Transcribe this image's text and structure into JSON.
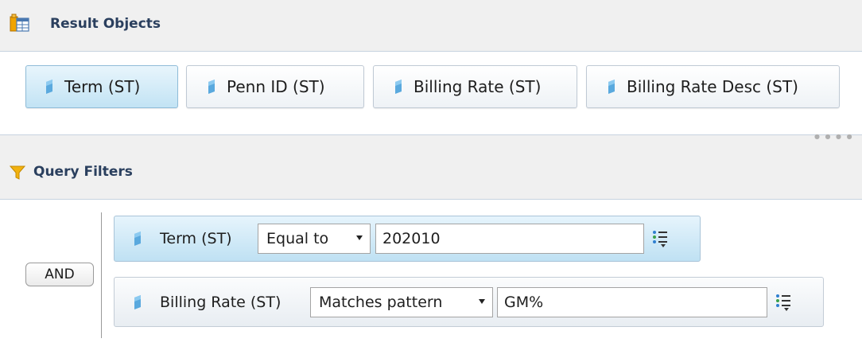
{
  "result_objects": {
    "title": "Result Objects",
    "icon": "table-icon",
    "items": [
      {
        "label": "Term (ST)",
        "selected": true
      },
      {
        "label": "Penn ID (ST)",
        "selected": false
      },
      {
        "label": "Billing Rate (ST)",
        "selected": false
      },
      {
        "label": "Billing Rate Desc (ST)",
        "selected": false
      }
    ]
  },
  "query_filters": {
    "title": "Query Filters",
    "icon": "funnel-icon",
    "operator_label": "AND",
    "filters": [
      {
        "object": "Term (ST)",
        "operator": "Equal to",
        "value": "202010"
      },
      {
        "object": "Billing Rate (ST)",
        "operator": "Matches pattern",
        "value": "GM%"
      }
    ]
  },
  "colors": {
    "header_text": "#2a3f5e",
    "selected_chip": "#c2e3f4",
    "dimension_icon": "#5aa9de",
    "funnel_icon": "#f2b20f"
  }
}
